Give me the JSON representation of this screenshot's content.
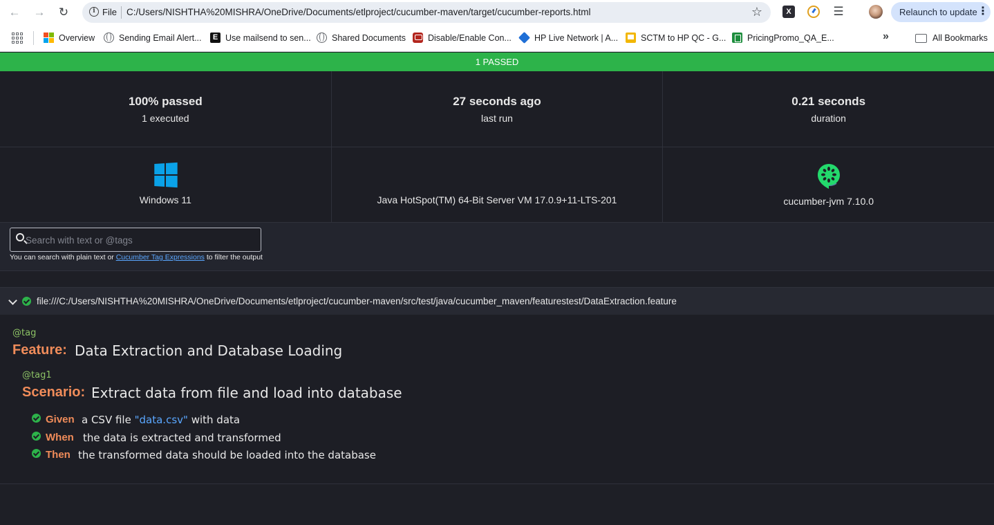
{
  "browser": {
    "omnibox_scheme": "File",
    "url": "C:/Users/NISHTHA%20MISHRA/OneDrive/Documents/etlproject/cucumber-maven/target/cucumber-reports.html",
    "relaunch_label": "Relaunch to update",
    "bookmarks": [
      "Overview",
      "Sending Email Alert...",
      "Use mailsend to sen...",
      "Shared Documents",
      "Disable/Enable Con...",
      "HP Live Network | A...",
      "SCTM to HP QC - G...",
      "PricingPromo_QA_E..."
    ],
    "all_bookmarks_label": "All Bookmarks"
  },
  "report": {
    "status_text": "1 PASSED",
    "status_color": "#2db34a",
    "stats": {
      "passed_main": "100% passed",
      "passed_sub": "1 executed",
      "lastrun_main": "27 seconds ago",
      "lastrun_sub": "last run",
      "duration_main": "0.21 seconds",
      "duration_sub": "duration"
    },
    "environment": {
      "os": "Windows 11",
      "jvm": "Java HotSpot(TM) 64-Bit Server VM 17.0.9+11-LTS-201",
      "framework": "cucumber-jvm 7.10.0"
    },
    "search": {
      "placeholder": "Search with text or @tags",
      "help_prefix": "You can search with plain text or",
      "help_link": "Cucumber Tag Expressions",
      "help_suffix": "to filter the output"
    },
    "feature": {
      "path": "file:///C:/Users/NISHTHA%20MISHRA/OneDrive/Documents/etlproject/cucumber-maven/src/test/java/cucumber_maven/featurestest/DataExtraction.feature",
      "tag": "@tag",
      "keyword": "Feature:",
      "name": "Data Extraction and Database Loading",
      "scenario": {
        "tag": "@tag1",
        "keyword": "Scenario:",
        "name": "Extract data from file and load into database",
        "steps": [
          {
            "keyword": "Given",
            "text_before": "a CSV file",
            "param": "\"data.csv\"",
            "text_after": "with data"
          },
          {
            "keyword": "When",
            "text": "the data is extracted and transformed"
          },
          {
            "keyword": "Then",
            "text": "the transformed data should be loaded into the database"
          }
        ]
      }
    }
  }
}
